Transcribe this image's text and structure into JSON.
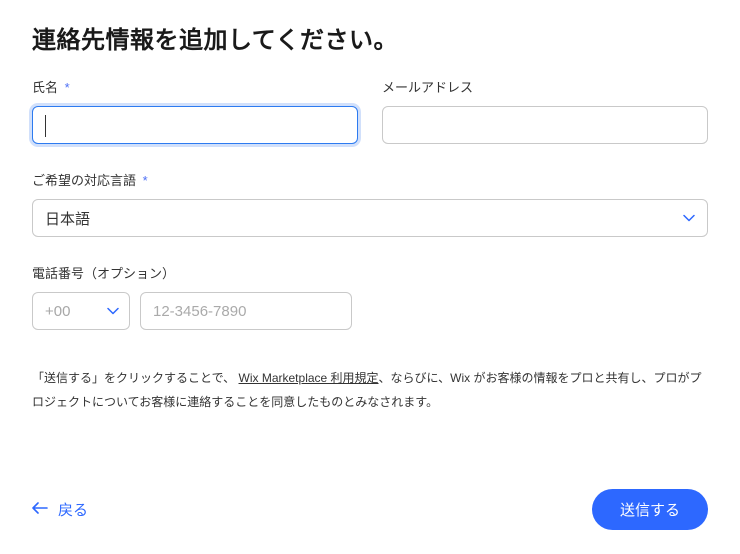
{
  "heading": "連絡先情報を追加してください。",
  "fields": {
    "name": {
      "label": "氏名",
      "required_mark": "*",
      "value": ""
    },
    "email": {
      "label": "メールアドレス",
      "value": ""
    },
    "language": {
      "label": "ご希望の対応言語",
      "required_mark": "*",
      "selected": "日本語"
    },
    "phone": {
      "label": "電話番号（オプション）",
      "country_code": "+00",
      "placeholder": "12-3456-7890"
    }
  },
  "disclaimer": {
    "part1": "「送信する」をクリックすることで、",
    "link_text": "Wix Marketplace 利用規定",
    "part2": "、ならびに、Wix がお客様の情報をプロと共有し、プロがプロジェクトについてお客様に連絡することを同意したものとみなされます。"
  },
  "footer": {
    "back_label": "戻る",
    "submit_label": "送信する"
  }
}
